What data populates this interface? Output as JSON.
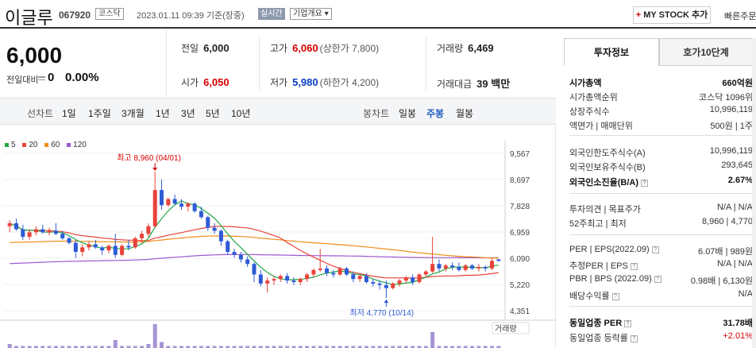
{
  "header": {
    "name": "이글루",
    "code": "067920",
    "market": "코스닥",
    "datetime": "2023.01.11 09:39 기준(장중)",
    "realtime": "실시간",
    "overview": "기업개요 ▾",
    "mystock": "MY STOCK 추가",
    "mystock_plus": "+",
    "quick_order": "빠른주문"
  },
  "price": {
    "current": "6,000",
    "compare_label": "전일대비",
    "compare_value": "0",
    "compare_rate": "0.00%"
  },
  "stats": {
    "prev_close": {
      "label": "전일",
      "value": "6,000"
    },
    "high": {
      "label": "고가",
      "value": "6,060",
      "sub": "(상한가 7,800)"
    },
    "volume": {
      "label": "거래량",
      "value": "6,469"
    },
    "open": {
      "label": "시가",
      "value": "6,050"
    },
    "low": {
      "label": "저가",
      "value": "5,980",
      "sub": "(하한가 4,200)"
    },
    "amount": {
      "label": "거래대금",
      "value": "39 백만"
    }
  },
  "toolbar": {
    "line_label": "선차트",
    "line_periods": [
      "1일",
      "1주일",
      "3개월",
      "1년",
      "3년",
      "5년",
      "10년"
    ],
    "candle_label": "봉차트",
    "candle_periods": [
      "일봉",
      "주봉",
      "월봉"
    ],
    "active_candle": "주봉"
  },
  "chart_data": {
    "type": "candlestick",
    "legend": [
      {
        "name": "5",
        "color": "#22a845"
      },
      {
        "name": "20",
        "color": "#e8423a"
      },
      {
        "name": "60",
        "color": "#f08c1a"
      },
      {
        "name": "120",
        "color": "#9b59d0"
      }
    ],
    "y_ticks": [
      "9,567",
      "8,697",
      "7,828",
      "6,959",
      "6,090",
      "5,220",
      "4,351"
    ],
    "ylim": [
      4351,
      9567
    ],
    "annotations": {
      "high": "최고 8,960 (04/01)",
      "low": "최저 4,770 (10/14)"
    },
    "volume_label": "거래량",
    "candles": [
      [
        7150,
        7350,
        6950,
        7250
      ],
      [
        7250,
        7400,
        7000,
        7050
      ],
      [
        7050,
        7200,
        6700,
        6800
      ],
      [
        6800,
        7050,
        6700,
        6950
      ],
      [
        6950,
        7150,
        6850,
        7050
      ],
      [
        7050,
        7200,
        6900,
        6950
      ],
      [
        6950,
        7100,
        6850,
        7000
      ],
      [
        7000,
        7250,
        6850,
        6900
      ],
      [
        6900,
        7000,
        6700,
        6750
      ],
      [
        6750,
        6800,
        6550,
        6600
      ],
      [
        6600,
        6700,
        6100,
        6300
      ],
      [
        6300,
        6550,
        6150,
        6450
      ],
      [
        6450,
        6650,
        6350,
        6550
      ],
      [
        6550,
        6700,
        6400,
        6450
      ],
      [
        6450,
        6500,
        6200,
        6350
      ],
      [
        6350,
        6550,
        6250,
        6500
      ],
      [
        6500,
        6900,
        6100,
        6200
      ],
      [
        6200,
        6550,
        6150,
        6500
      ],
      [
        6500,
        6700,
        6350,
        6450
      ],
      [
        6450,
        6800,
        6400,
        6750
      ],
      [
        6750,
        7000,
        6600,
        6900
      ],
      [
        6900,
        7250,
        6800,
        7150
      ],
      [
        7150,
        8960,
        7100,
        8350
      ],
      [
        8350,
        8700,
        7700,
        7850
      ],
      [
        7850,
        8100,
        7800,
        8050
      ],
      [
        8050,
        8200,
        7850,
        7900
      ],
      [
        7900,
        8050,
        7700,
        7800
      ],
      [
        7800,
        7950,
        7650,
        7900
      ],
      [
        7900,
        7950,
        7600,
        7650
      ],
      [
        7650,
        7800,
        7400,
        7450
      ],
      [
        7450,
        7500,
        7000,
        7100
      ],
      [
        7100,
        7250,
        6900,
        7000
      ],
      [
        7000,
        7050,
        6500,
        6650
      ],
      [
        6650,
        6700,
        6200,
        6300
      ],
      [
        6300,
        6400,
        6100,
        6200
      ],
      [
        6200,
        6300,
        5950,
        6050
      ],
      [
        6050,
        6150,
        5800,
        5900
      ],
      [
        5900,
        5950,
        5300,
        5550
      ],
      [
        5550,
        5700,
        5150,
        5250
      ],
      [
        5250,
        5450,
        4950,
        5350
      ],
      [
        5350,
        5500,
        5200,
        5400
      ],
      [
        5400,
        5550,
        5300,
        5500
      ],
      [
        5500,
        5600,
        5250,
        5350
      ],
      [
        5350,
        5450,
        5200,
        5300
      ],
      [
        5300,
        5450,
        5200,
        5400
      ],
      [
        5400,
        5600,
        5300,
        5550
      ],
      [
        5550,
        5750,
        5450,
        5700
      ],
      [
        5700,
        6400,
        5650,
        5750
      ],
      [
        5750,
        5850,
        5500,
        5600
      ],
      [
        5600,
        5700,
        5450,
        5550
      ],
      [
        5550,
        5800,
        5500,
        5750
      ],
      [
        5750,
        5800,
        5500,
        5550
      ],
      [
        5550,
        5650,
        5300,
        5400
      ],
      [
        5400,
        5550,
        5300,
        5500
      ],
      [
        5500,
        5600,
        5250,
        5300
      ],
      [
        5300,
        5400,
        5150,
        5250
      ],
      [
        5250,
        5350,
        5050,
        5200
      ],
      [
        5200,
        5350,
        4770,
        5100
      ],
      [
        5100,
        5300,
        5050,
        5250
      ],
      [
        5250,
        5400,
        5150,
        5350
      ],
      [
        5350,
        5500,
        5250,
        5450
      ],
      [
        5450,
        5550,
        5200,
        5300
      ],
      [
        5300,
        5600,
        5250,
        5550
      ],
      [
        5550,
        5700,
        5450,
        5650
      ],
      [
        5650,
        6800,
        5600,
        5900
      ],
      [
        5900,
        6050,
        5650,
        5750
      ],
      [
        5750,
        5900,
        5650,
        5850
      ],
      [
        5850,
        5950,
        5700,
        5800
      ],
      [
        5800,
        5950,
        5650,
        5700
      ],
      [
        5700,
        5900,
        5650,
        5850
      ],
      [
        5850,
        5900,
        5700,
        5750
      ],
      [
        5750,
        5900,
        5650,
        5800
      ],
      [
        5800,
        5850,
        5650,
        5750
      ],
      [
        5750,
        6100,
        5700,
        6000
      ],
      [
        6050,
        6060,
        5980,
        6000
      ]
    ],
    "volumes": [
      2,
      1,
      1,
      1,
      1,
      1,
      1,
      1,
      1,
      1,
      1,
      1,
      1,
      1,
      1,
      1,
      4,
      1,
      1,
      1,
      1,
      2,
      12,
      3,
      1,
      1,
      1,
      1,
      1,
      1,
      1,
      1,
      1,
      1,
      1,
      1,
      1,
      1,
      1,
      1,
      1,
      1,
      1,
      1,
      1,
      1,
      1,
      1,
      1,
      1,
      1,
      1,
      1,
      1,
      1,
      1,
      1,
      1,
      1,
      1,
      1,
      1,
      1,
      1,
      8,
      1,
      1,
      1,
      1,
      1,
      1,
      1,
      1,
      1,
      1
    ]
  },
  "side": {
    "tab_on": "투자정보",
    "tab_off": "호가10단계",
    "rows": [
      {
        "k": "시가총액",
        "v": "660억원",
        "bold": true
      },
      {
        "k": "시가총액순위",
        "v": "코스닥 1096위"
      },
      {
        "k": "상장주식수",
        "v": "10,996,119"
      },
      {
        "k": "액면가 | 매매단위",
        "v": "500원 | 1주"
      },
      {
        "k": "외국인한도주식수(A)",
        "v": "10,996,119"
      },
      {
        "k": "외국인보유주식수(B)",
        "v": "293,645"
      },
      {
        "k": "외국인소진율(B/A)",
        "v": "2.67%",
        "bold": true,
        "q": true
      },
      {
        "k": "투자의견 | 목표주가",
        "v": "N/A | N/A"
      },
      {
        "k": "52주최고 | 최저",
        "v": "8,960 | 4,770"
      },
      {
        "k": "PER | EPS(2022.09)",
        "v": "6.07배 | 989원",
        "q": true
      },
      {
        "k": "추정PER | EPS",
        "v": "N/A | N/A",
        "q": true
      },
      {
        "k": "PBR | BPS (2022.09)",
        "v": "0.98배 | 6,130원",
        "q": true
      },
      {
        "k": "배당수익률",
        "v": "N/A",
        "q": true
      },
      {
        "k": "동일업종 PER",
        "v": "31.78배",
        "bold": true,
        "q": true
      },
      {
        "k": "동일업종 등락률",
        "v": "+2.01%",
        "q": true
      }
    ],
    "q_mark": "?"
  }
}
